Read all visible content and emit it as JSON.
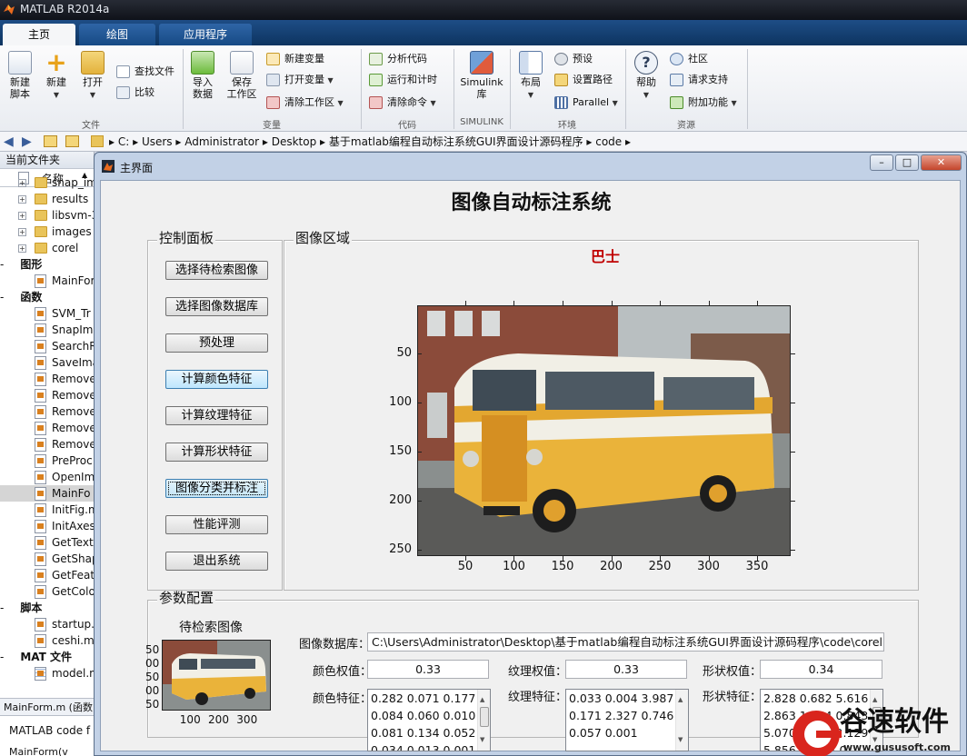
{
  "app": {
    "title": "MATLAB R2014a"
  },
  "tabs": [
    "主页",
    "绘图",
    "应用程序"
  ],
  "ribbon": {
    "file": {
      "group_label": "文件",
      "new_script": "新建\n脚本",
      "new": "新建",
      "open": "打开",
      "find_files": "查找文件",
      "compare": "比较"
    },
    "variable": {
      "group_label": "变量",
      "import_data": "导入\n数据",
      "save_workspace": "保存\n工作区",
      "new_variable": "新建变量",
      "open_variable": "打开变量",
      "clear_workspace": "清除工作区"
    },
    "code": {
      "group_label": "代码",
      "analyze_code": "分析代码",
      "run_and_time": "运行和计时",
      "clear_commands": "清除命令"
    },
    "simulink": {
      "group_label": "SIMULINK",
      "library": "Simulink\n库"
    },
    "environment": {
      "group_label": "环境",
      "layout": "布局",
      "preferences": "预设",
      "set_path": "设置路径",
      "parallel": "Parallel"
    },
    "resources": {
      "group_label": "资源",
      "help": "帮助",
      "community": "社区",
      "request_support": "请求支持",
      "addons": "附加功能"
    }
  },
  "address": {
    "segments": [
      "C:",
      "Users",
      "Administrator",
      "Desktop",
      "基于matlab编程自动标注系统GUI界面设计源码程序",
      "code"
    ]
  },
  "left_panel": {
    "title": "当前文件夹",
    "column": "名称",
    "items": [
      {
        "label": "snap_im",
        "kind": "folder",
        "expand": "+"
      },
      {
        "label": "results",
        "kind": "folder",
        "expand": "+"
      },
      {
        "label": "libsvm-3",
        "kind": "folder",
        "expand": "+"
      },
      {
        "label": "images",
        "kind": "folder",
        "expand": "+"
      },
      {
        "label": "corel",
        "kind": "folder",
        "expand": "+"
      },
      {
        "label": "图形",
        "kind": "section",
        "expand": "-"
      },
      {
        "label": "MainFor",
        "kind": "file"
      },
      {
        "label": "函数",
        "kind": "section",
        "expand": "-"
      },
      {
        "label": "SVM_Tr",
        "kind": "file"
      },
      {
        "label": "SnapIm",
        "kind": "file"
      },
      {
        "label": "SearchR",
        "kind": "file"
      },
      {
        "label": "SaveIma",
        "kind": "file"
      },
      {
        "label": "Remove",
        "kind": "file"
      },
      {
        "label": "Remove",
        "kind": "file"
      },
      {
        "label": "Remove",
        "kind": "file"
      },
      {
        "label": "Remove",
        "kind": "file"
      },
      {
        "label": "Remove",
        "kind": "file"
      },
      {
        "label": "PreProc",
        "kind": "file"
      },
      {
        "label": "OpenIm",
        "kind": "file"
      },
      {
        "label": "MainFo",
        "kind": "file",
        "selected": true
      },
      {
        "label": "InitFig.m",
        "kind": "file"
      },
      {
        "label": "InitAxes",
        "kind": "file"
      },
      {
        "label": "GetText",
        "kind": "file"
      },
      {
        "label": "GetShap",
        "kind": "file"
      },
      {
        "label": "GetFeat",
        "kind": "file"
      },
      {
        "label": "GetColo",
        "kind": "file"
      },
      {
        "label": "脚本",
        "kind": "section",
        "expand": "-"
      },
      {
        "label": "startup.",
        "kind": "file"
      },
      {
        "label": "ceshi.m",
        "kind": "file"
      },
      {
        "label": "MAT 文件",
        "kind": "section",
        "expand": "-"
      },
      {
        "label": "model.m",
        "kind": "matfile"
      }
    ],
    "detail_title": "MainForm.m (函数",
    "detail_text": "MATLAB code f",
    "detail_bottom": "MainForm(v"
  },
  "gui": {
    "window_title": "主界面",
    "main_title": "图像自动标注系统",
    "control_panel": {
      "title": "控制面板",
      "buttons": [
        "选择待检索图像",
        "选择图像数据库",
        "预处理",
        "计算颜色特征",
        "计算纹理特征",
        "计算形状特征",
        "图像分类并标注",
        "性能评测",
        "退出系统"
      ]
    },
    "image_area": {
      "title": "图像区域",
      "label": "巴士",
      "label_color": "#c00000",
      "x_ticks": [
        "50",
        "100",
        "150",
        "200",
        "250",
        "300",
        "350"
      ],
      "y_ticks": [
        "50",
        "100",
        "150",
        "200",
        "250"
      ]
    },
    "params": {
      "title": "参数配置",
      "query_image_label": "待检索图像",
      "thumb_y_ticks": [
        "50",
        "00",
        "50",
        "00",
        "50"
      ],
      "thumb_x_ticks": [
        "100",
        "200",
        "300"
      ],
      "db_label": "图像数据库：",
      "db_path": "C:\\Users\\Administrator\\Desktop\\基于matlab编程自动标注系统GUI界面设计源码程序\\code\\corel",
      "color_weight_label": "颜色权值：",
      "color_weight": "0.33",
      "texture_weight_label": "纹理权值：",
      "texture_weight": "0.33",
      "shape_weight_label": "形状权值：",
      "shape_weight": "0.34",
      "color_feature_label": "颜色特征：",
      "color_feature_lines": [
        "0.282 0.071 0.177",
        "0.084 0.060 0.010",
        "0.081 0.134 0.052",
        "0.034 0.013 0.001"
      ],
      "texture_feature_label": "纹理特征：",
      "texture_feature_lines": [
        "0.033 0.004 3.987",
        "0.171 2.327 0.746",
        "0.057 0.001"
      ],
      "shape_feature_label": "形状特征：",
      "shape_feature_lines": [
        "2.828 0.682 5.616",
        "2.863 1.584 0.843",
        "5.070 4.696 2.129",
        "5.856 5.13 4.0"
      ]
    }
  },
  "watermark": {
    "name": "谷速软件",
    "url": "www.gususoft.com"
  }
}
